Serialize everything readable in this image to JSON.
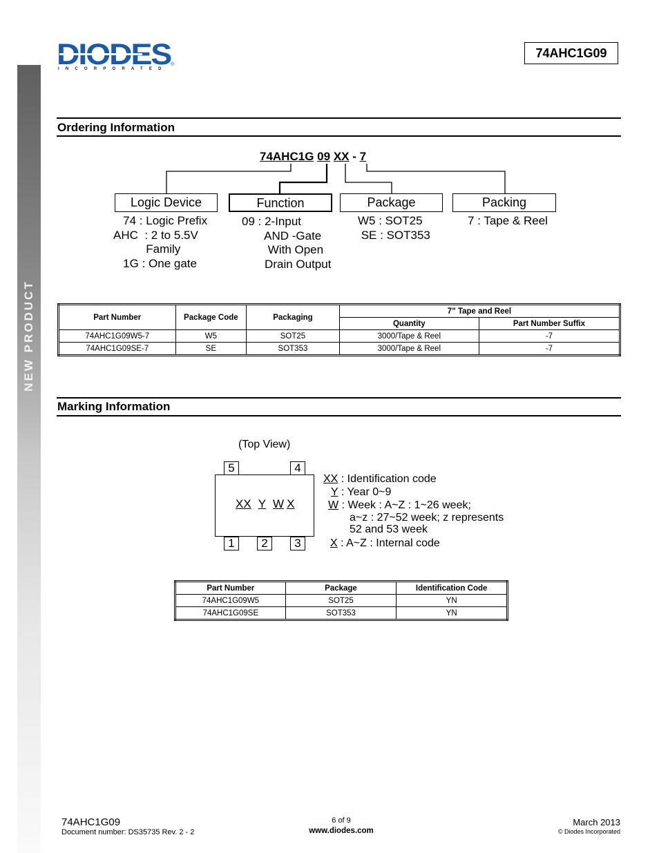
{
  "side_banner": "NEW PRODUCT",
  "logo": {
    "brand": "DIODES",
    "tagline": "INCORPORATED",
    "reg": "®"
  },
  "header": {
    "part_number": "74AHC1G09"
  },
  "ordering": {
    "title": "Ordering Information",
    "code": {
      "prefix": "74AHC1G",
      "function": "09",
      "package": "XX",
      "dash": " - ",
      "packing": "7"
    },
    "categories": [
      {
        "label": "Logic Device",
        "lines": [
          "   74 : Logic Prefix",
          "AHC  : 2 to 5.5V",
          "          Family",
          "   1G : One gate"
        ]
      },
      {
        "label": "Function",
        "lines": [
          "09 : 2-Input",
          "       AND -Gate",
          "        With Open",
          "       Drain Output"
        ]
      },
      {
        "label": "Package",
        "lines": [
          "W5 : SOT25",
          " SE : SOT353"
        ]
      },
      {
        "label": "Packing",
        "lines": [
          "7 : Tape & Reel"
        ]
      }
    ],
    "table": {
      "headers": {
        "part_number": "Part Number",
        "package_code": "Package Code",
        "packaging": "Packaging",
        "group": "7” Tape and Reel",
        "quantity": "Quantity",
        "suffix": "Part Number Suffix"
      },
      "rows": [
        {
          "part_number": "74AHC1G09W5-7",
          "package_code": "W5",
          "packaging": "SOT25",
          "quantity": "3000/Tape & Reel",
          "suffix": "-7"
        },
        {
          "part_number": "74AHC1G09SE-7",
          "package_code": "SE",
          "packaging": "SOT353",
          "quantity": "3000/Tape & Reel",
          "suffix": "-7"
        }
      ]
    }
  },
  "marking": {
    "title": "Marking Information",
    "top_view": "(Top View)",
    "pins_top": [
      "5",
      "4"
    ],
    "pins_bottom": [
      "1",
      "2",
      "3"
    ],
    "chip_marks": [
      "XX",
      "Y",
      "W",
      "X"
    ],
    "legend": [
      {
        "key": "XX",
        "text": " : Identification code"
      },
      {
        "key": "Y",
        "text": " : Year 0~9"
      },
      {
        "key": "W",
        "text": " : Week : A~Z : 1~26 week;"
      },
      {
        "key": "",
        "text": "a~z : 27~52 week; z represents"
      },
      {
        "key": "",
        "text": "52 and 53 week"
      },
      {
        "key": "X",
        "text": " : A~Z : Internal code"
      }
    ],
    "table": {
      "headers": [
        "Part Number",
        "Package",
        "Identification Code"
      ],
      "rows": [
        [
          "74AHC1G09W5",
          "SOT25",
          "YN"
        ],
        [
          "74AHC1G09SE",
          "SOT353",
          "YN"
        ]
      ]
    }
  },
  "footer": {
    "part": "74AHC1G09",
    "doc_number": "Document number: DS35735 Rev. 2 - 2",
    "page": "6 of 9",
    "website": "www.diodes.com",
    "date": "March 2013",
    "copyright": "© Diodes Incorporated"
  }
}
